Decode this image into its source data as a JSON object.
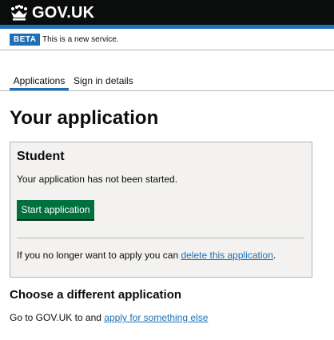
{
  "header": {
    "logo_text": "GOV.UK",
    "logo_icon": "crown-icon",
    "background_color": "#0b0c0c",
    "accent_color": "#1d70b8"
  },
  "phase_banner": {
    "tag": "BETA",
    "text": "This is a new service."
  },
  "tabs": [
    {
      "label": "Applications",
      "selected": true
    },
    {
      "label": "Sign in details",
      "selected": false
    }
  ],
  "page": {
    "title": "Your application"
  },
  "application_card": {
    "heading": "Student",
    "status": "Your application has not been started.",
    "start_button_label": "Start application",
    "start_button_color": "#00703c",
    "delete_prefix": "If you no longer want to apply you can ",
    "delete_link": "delete this application",
    "delete_suffix": "."
  },
  "other_application": {
    "heading": "Choose a different application",
    "prefix": "Go to GOV.UK to and ",
    "link": "apply for something else"
  }
}
